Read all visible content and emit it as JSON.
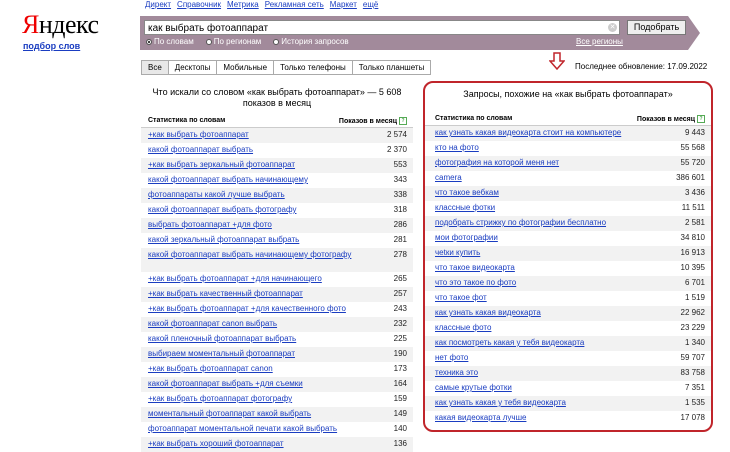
{
  "logo": {
    "y_letter": "Я",
    "rest": "ндекс",
    "sub": "подбор слов"
  },
  "topnav": [
    "Директ",
    "Справочник",
    "Метрика",
    "Рекламная сеть",
    "Маркет",
    "ещё"
  ],
  "search": {
    "value": "как выбрать фотоаппарат",
    "button": "Подобрать",
    "regions": "Все регионы"
  },
  "radios": [
    {
      "label": "По словам",
      "checked": true
    },
    {
      "label": "По регионам",
      "checked": false
    },
    {
      "label": "История запросов",
      "checked": false
    }
  ],
  "tabs": [
    "Все",
    "Десктопы",
    "Мобильные",
    "Только телефоны",
    "Только планшеты"
  ],
  "updated": "Последнее обновление: 17.09.2022",
  "left": {
    "title": "Что искали со словом «как выбрать фотоаппарат» — 5 608 показов в месяц",
    "col1": "Статистика по словам",
    "col2": "Показов в месяц",
    "rows": [
      {
        "q": "+как выбрать фотоаппарат",
        "n": "2 574"
      },
      {
        "q": "какой фотоаппарат выбрать",
        "n": "2 370"
      },
      {
        "q": "+как выбрать зеркальный фотоаппарат",
        "n": "553"
      },
      {
        "q": "какой фотоаппарат выбрать начинающему",
        "n": "343"
      },
      {
        "q": "фотоаппараты какой лучше выбрать",
        "n": "338"
      },
      {
        "q": "какой фотоаппарат выбрать фотографу",
        "n": "318"
      },
      {
        "q": "выбрать фотоаппарат +для фото",
        "n": "286"
      },
      {
        "q": "какой зеркальный фотоаппарат выбрать",
        "n": "281"
      },
      {
        "q": "какой фотоаппарат выбрать начинающему фотографу",
        "n": "278",
        "tall": true
      },
      {
        "q": "+как выбрать фотоаппарат +для начинающего",
        "n": "265"
      },
      {
        "q": "+как выбрать качественный фотоаппарат",
        "n": "257"
      },
      {
        "q": "+как выбрать фотоаппарат +для качественного фото",
        "n": "243"
      },
      {
        "q": "какой фотоаппарат canon выбрать",
        "n": "232"
      },
      {
        "q": "какой пленочный фотоаппарат выбрать",
        "n": "225"
      },
      {
        "q": "выбираем моментальный фотоаппарат",
        "n": "190"
      },
      {
        "q": "+как выбрать фотоаппарат canon",
        "n": "173"
      },
      {
        "q": "какой фотоаппарат выбрать +для съемки",
        "n": "164"
      },
      {
        "q": "+как выбрать фотоаппарат фотографу",
        "n": "159"
      },
      {
        "q": "моментальный фотоаппарат какой выбрать",
        "n": "149"
      },
      {
        "q": "фотоаппарат моментальной печати какой выбрать",
        "n": "140"
      },
      {
        "q": "+как выбрать хороший фотоаппарат",
        "n": "136"
      }
    ]
  },
  "right": {
    "title": "Запросы, похожие на «как выбрать фотоаппарат»",
    "col1": "Статистика по словам",
    "col2": "Показов в месяц",
    "rows": [
      {
        "q": "как узнать какая видеокарта стоит на компьютере",
        "n": "9 443"
      },
      {
        "q": "кто на фото",
        "n": "55 568"
      },
      {
        "q": "фотография на которой меня нет",
        "n": "55 720"
      },
      {
        "q": "camera",
        "n": "386 601"
      },
      {
        "q": "что такое вебкам",
        "n": "3 436"
      },
      {
        "q": "классные фотки",
        "n": "11 511"
      },
      {
        "q": "подобрать стрижку по фотографии бесплатно",
        "n": "2 581"
      },
      {
        "q": "мои фотографии",
        "n": "34 810"
      },
      {
        "q": "чеtки купить",
        "n": "16 913"
      },
      {
        "q": "что такое видеокарта",
        "n": "10 395"
      },
      {
        "q": "что это такое по фото",
        "n": "6 701"
      },
      {
        "q": "что такое фот",
        "n": "1 519"
      },
      {
        "q": "как узнать какая видеокарта",
        "n": "22 962"
      },
      {
        "q": "классные фото",
        "n": "23 229"
      },
      {
        "q": "как посмотреть какая у тебя видеокарта",
        "n": "1 340"
      },
      {
        "q": "нет фото",
        "n": "59 707"
      },
      {
        "q": "техника это",
        "n": "83 758"
      },
      {
        "q": "самые крутые фотки",
        "n": "7 351"
      },
      {
        "q": "как узнать какая у тебя видеокарта",
        "n": "1 535"
      },
      {
        "q": "какая видеокарта лучше",
        "n": "17 078"
      }
    ]
  }
}
